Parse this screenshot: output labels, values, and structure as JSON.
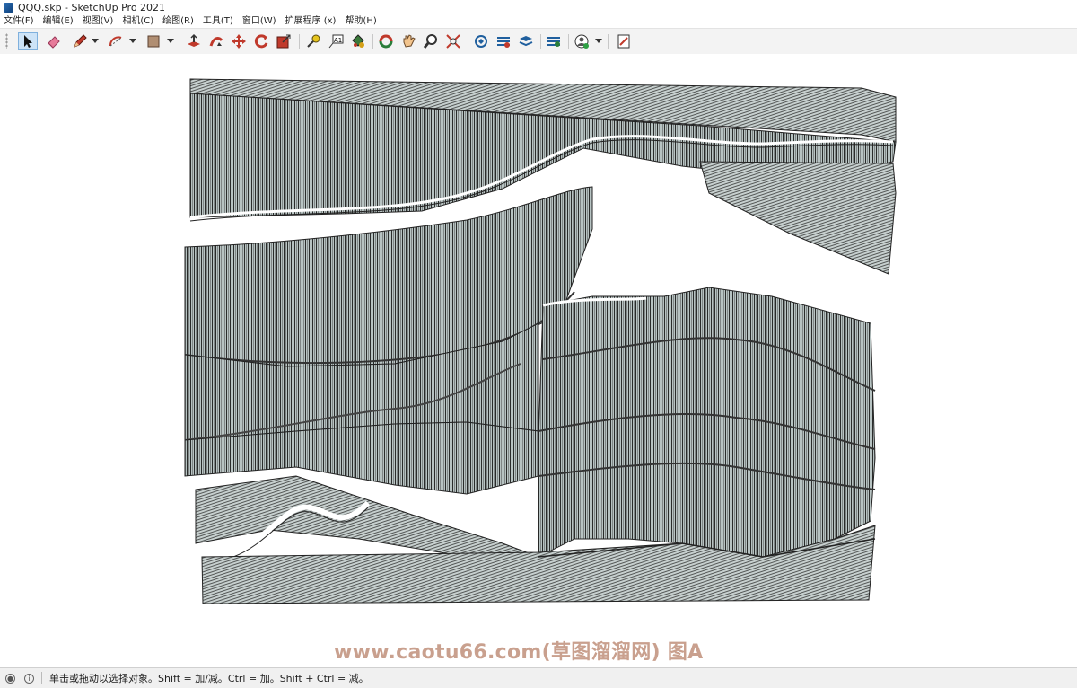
{
  "window": {
    "title": "QQQ.skp - SketchUp Pro 2021"
  },
  "menu": {
    "items": [
      "文件(F)",
      "编辑(E)",
      "视图(V)",
      "相机(C)",
      "绘图(R)",
      "工具(T)",
      "窗口(W)",
      "扩展程序 (x)",
      "帮助(H)"
    ]
  },
  "toolbar": {
    "tools": [
      {
        "name": "select-tool",
        "icon": "arrow-cursor-icon",
        "active": true
      },
      {
        "name": "eraser-tool",
        "icon": "eraser-icon"
      },
      {
        "name": "line-tool",
        "icon": "pencil-icon"
      },
      {
        "name": "arc-tool",
        "icon": "arc-icon"
      },
      {
        "name": "shape-tool",
        "icon": "rectangle-icon"
      },
      {
        "name": "push-pull-tool",
        "icon": "push-pull-icon"
      },
      {
        "name": "follow-me-tool",
        "icon": "follow-me-icon"
      },
      {
        "name": "move-tool",
        "icon": "move-icon"
      },
      {
        "name": "rotate-tool",
        "icon": "rotate-icon"
      },
      {
        "name": "scale-tool",
        "icon": "scale-icon"
      },
      {
        "name": "tape-measure-tool",
        "icon": "tape-measure-icon"
      },
      {
        "name": "text-tool",
        "icon": "text-icon"
      },
      {
        "name": "paint-bucket-tool",
        "icon": "paint-bucket-icon"
      },
      {
        "name": "orbit-tool",
        "icon": "orbit-icon"
      },
      {
        "name": "pan-tool",
        "icon": "hand-icon"
      },
      {
        "name": "zoom-tool",
        "icon": "magnifier-icon"
      },
      {
        "name": "zoom-extents-tool",
        "icon": "zoom-extents-icon"
      },
      {
        "name": "3d-warehouse-tool",
        "icon": "warehouse-icon"
      },
      {
        "name": "extension-warehouse-tool",
        "icon": "extension-warehouse-icon"
      },
      {
        "name": "layout-tool",
        "icon": "layout-icon"
      },
      {
        "name": "extension-manager-tool",
        "icon": "extension-manager-icon"
      },
      {
        "name": "account-tool",
        "icon": "account-icon"
      },
      {
        "name": "model-info-tool",
        "icon": "model-info-icon"
      }
    ]
  },
  "watermark": "www.caotu66.com(草图溜溜网) 图A",
  "status": {
    "text": "单击或拖动以选择对象。Shift = 加/减。Ctrl = 加。Shift + Ctrl = 减。",
    "geo_icon": "geolocation-icon",
    "info_icon": "info-icon"
  },
  "colors": {
    "model_fill": "#b7c3c2",
    "model_line": "#1a1a1a",
    "toolbar_bg": "#f3f3f3",
    "active_tool": "#cde3f7"
  }
}
